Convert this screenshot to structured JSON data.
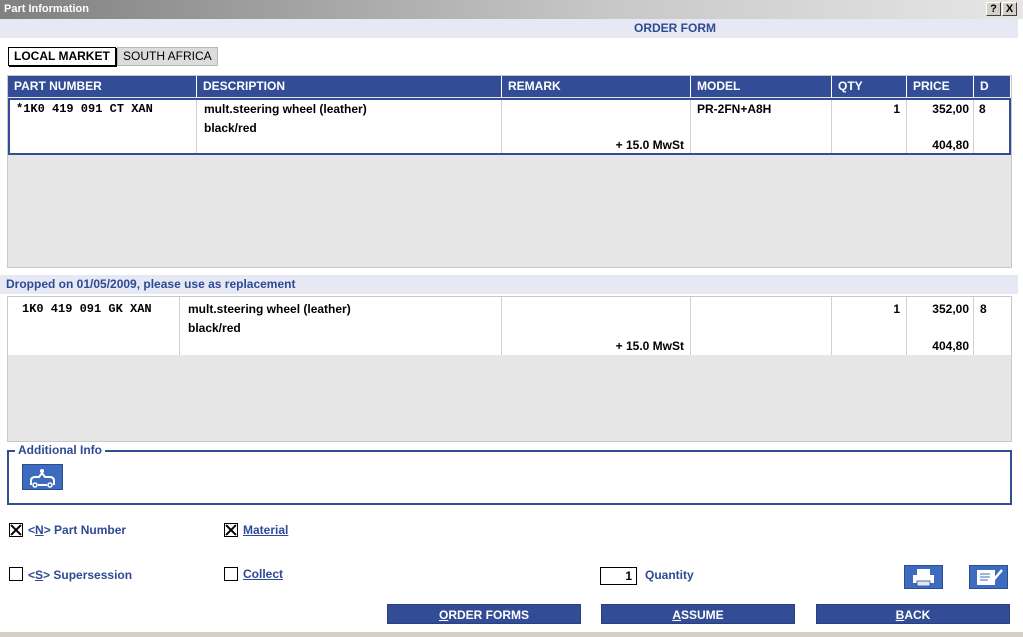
{
  "window": {
    "title": "Part Information",
    "help": "?",
    "close": "X"
  },
  "header": {
    "title": "ORDER FORM"
  },
  "tabs": [
    {
      "label": "LOCAL MARKET",
      "active": true
    },
    {
      "label": "SOUTH AFRICA",
      "active": false
    }
  ],
  "table": {
    "columns": [
      "PART NUMBER",
      "DESCRIPTION",
      "REMARK",
      "MODEL",
      "QTY",
      "PRICE",
      "D"
    ],
    "row": {
      "part_number": "*1K0 419 091 CT XAN",
      "description_line1": "mult.steering wheel (leather)",
      "description_line2": "black/red",
      "remark": "+ 15.0 MwSt",
      "model": "PR-2FN+A8H",
      "qty": "1",
      "price": "352,00",
      "price_gross": "404,80",
      "d": "8"
    }
  },
  "replacement": {
    "notice": "Dropped on 01/05/2009, please use as replacement",
    "row": {
      "part_number": "1K0 419 091 GK XAN",
      "description_line1": "mult.steering wheel (leather)",
      "description_line2": "black/red",
      "remark": "+ 15.0 MwSt",
      "model": "",
      "qty": "1",
      "price": "352,00",
      "price_gross": "404,80",
      "d": "8"
    }
  },
  "additional_info": {
    "label": "Additional Info",
    "icon": "vehicle-icon"
  },
  "options": {
    "part_number": {
      "prefix": "<",
      "key": "N",
      "suffix": "> Part Number",
      "checked": true
    },
    "material": {
      "key": "M",
      "rest": "aterial",
      "checked": true
    },
    "supersession": {
      "prefix": "<",
      "key": "S",
      "suffix": "> Supersession",
      "checked": false
    },
    "collect": {
      "key": "C",
      "rest": "ollect",
      "checked": false
    }
  },
  "quantity": {
    "value": "1",
    "label": "Quantity"
  },
  "buttons": {
    "order_forms": {
      "key": "O",
      "rest": "RDER FORMS"
    },
    "assume": {
      "key": "A",
      "rest": "SSUME"
    },
    "back": {
      "key": "B",
      "rest": "ACK"
    }
  },
  "colors": {
    "accent": "#324d95",
    "header_text": "#2e4a94",
    "band": "#e6e8f4"
  }
}
